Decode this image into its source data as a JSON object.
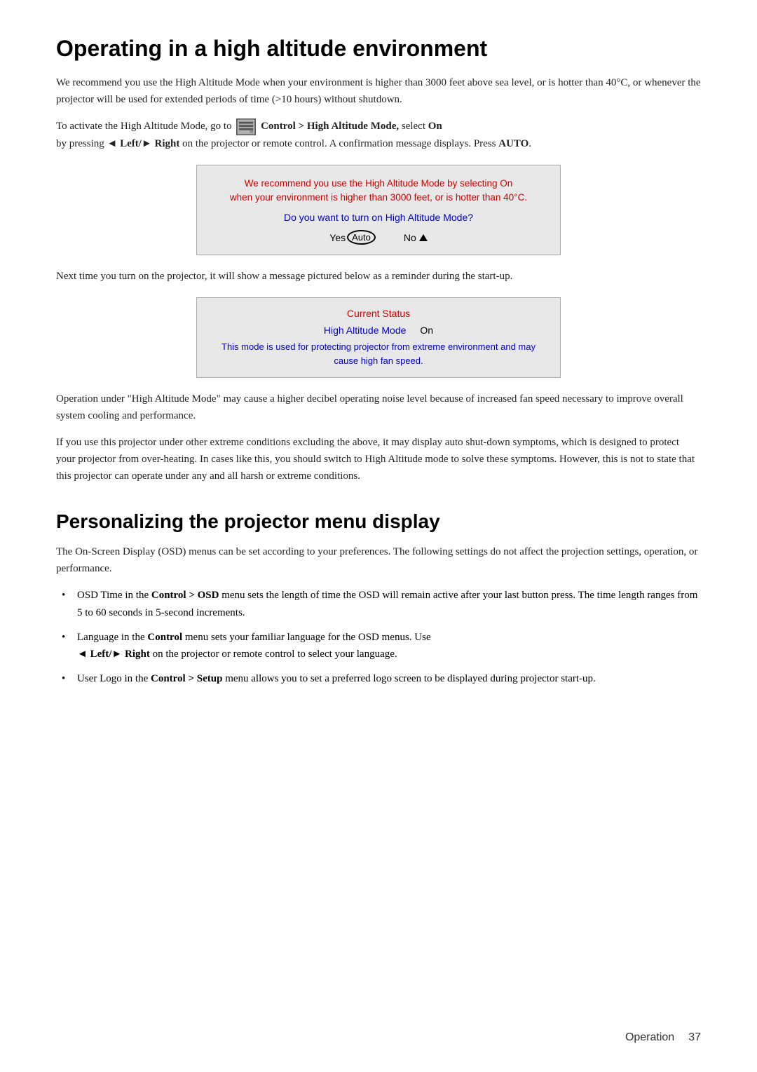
{
  "page": {
    "title": "Operating in a high altitude environment",
    "section2_title": "Personalizing the projector menu display",
    "footer_section": "Operation",
    "footer_page": "37"
  },
  "intro_para": "We recommend you use the High Altitude Mode when your environment is higher than 3000 feet above sea level, or is hotter than 40°C, or whenever the projector will be used for extended periods of time (>10 hours) without shutdown.",
  "activate_text_before": "To activate the High Altitude Mode, go to",
  "activate_text_after_icon": "Control > High Altitude Mode, select On",
  "activate_text_after": "by pressing",
  "activate_text_left": "◄ Left/",
  "activate_text_right": "► Right",
  "activate_text_rest": "on the projector or remote control. A confirmation message displays. Press",
  "activate_text_auto": "AUTO.",
  "dialog": {
    "warning_line1": "We recommend you use the High Altitude Mode by selecting On",
    "warning_line2": "when your environment is higher than 3000 feet, or is hotter than 40°C.",
    "question": "Do you want to turn on High Altitude Mode?",
    "yes_label": "Yes",
    "auto_badge": "Auto",
    "no_label": "No"
  },
  "reminder_para": "Next time you turn on the projector, it will show a message pictured below as a reminder during the start-up.",
  "status_box": {
    "title": "Current Status",
    "mode_label": "High Altitude Mode",
    "mode_value": "On",
    "note": "This mode is used for protecting projector from extreme environment and may cause high fan speed."
  },
  "noise_para": "Operation under \"High Altitude Mode\" may cause a higher decibel operating noise level because of increased fan speed necessary to improve overall system cooling and performance.",
  "extreme_para": "If you use this projector under other extreme conditions excluding the above, it may display auto shut-down symptoms, which is designed to protect your projector from over-heating. In cases like this, you should switch to High Altitude mode to solve these symptoms. However, this is not to state that this projector can operate under any and all harsh or extreme conditions.",
  "section2_para": "The On-Screen Display (OSD) menus can be set according to your preferences. The following settings do not affect the projection settings, operation, or performance.",
  "bullets": [
    {
      "text_before": "OSD Time in the",
      "bold1": "Control > OSD",
      "text_middle": "menu sets the length of time the OSD will remain active after your last button press. The time length ranges from 5 to 60 seconds in 5-second increments."
    },
    {
      "text_before": "Language in the",
      "bold1": "Control",
      "text_middle": "menu sets your familiar language for the OSD menus. Use",
      "left_arrow": "◄ Left/",
      "right_arrow": "► Right",
      "text_end": "on the projector or remote control to select your language."
    },
    {
      "text_before": "User Logo in the",
      "bold1": "Control > Setup",
      "text_middle": "menu allows you to set a preferred logo screen to be displayed during projector start-up."
    }
  ]
}
